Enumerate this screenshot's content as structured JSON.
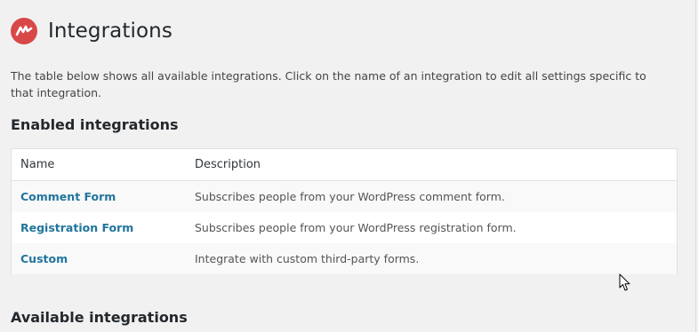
{
  "header": {
    "title": "Integrations",
    "logo_icon": "mailchimp-logo-icon",
    "logo_color": "#d94848"
  },
  "intro": "The table below shows all available integrations. Click on the name of an integration to edit all settings specific to that integration.",
  "enabled_section": {
    "heading": "Enabled integrations",
    "columns": [
      "Name",
      "Description"
    ],
    "rows": [
      {
        "name": "Comment Form",
        "description": "Subscribes people from your WordPress comment form."
      },
      {
        "name": "Registration Form",
        "description": "Subscribes people from your WordPress registration form."
      },
      {
        "name": "Custom",
        "description": "Integrate with custom third-party forms."
      }
    ]
  },
  "available_section": {
    "heading": "Available integrations"
  },
  "colors": {
    "link": "#21759b",
    "background": "#f1f1f1"
  }
}
